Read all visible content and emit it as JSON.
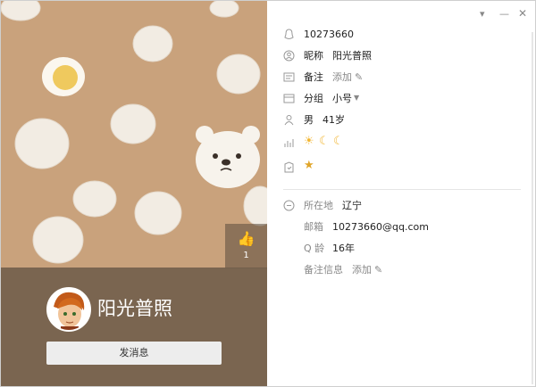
{
  "window": {
    "min_icon": "chevron-down-icon",
    "minimize_icon": "minimize-icon",
    "close_icon": "close-icon"
  },
  "cover": {
    "like_count": "1",
    "nickname": "阳光普照",
    "message_button": "发消息"
  },
  "profile": {
    "qq_number": "10273660",
    "nick_label": "昵称",
    "nick_value": "阳光普照",
    "remark_label": "备注",
    "remark_action": "添加",
    "group_label": "分组",
    "group_value": "小号",
    "gender": "男",
    "age": "41岁",
    "level_icons": [
      "sun-icon",
      "moon-icon",
      "moon-icon"
    ],
    "badge_icon": "star-badge-icon"
  },
  "details": {
    "location_label": "所在地",
    "location_value": "辽宁",
    "email_label": "邮箱",
    "email_value": "10273660@qq.com",
    "qage_label": "Q 龄",
    "qage_value": "16年",
    "note_label": "备注信息",
    "note_action": "添加"
  },
  "colors": {
    "cover_bg": "#c9a27c",
    "panel_bg": "#6e5c4a",
    "level_gold": "#f2b632"
  }
}
